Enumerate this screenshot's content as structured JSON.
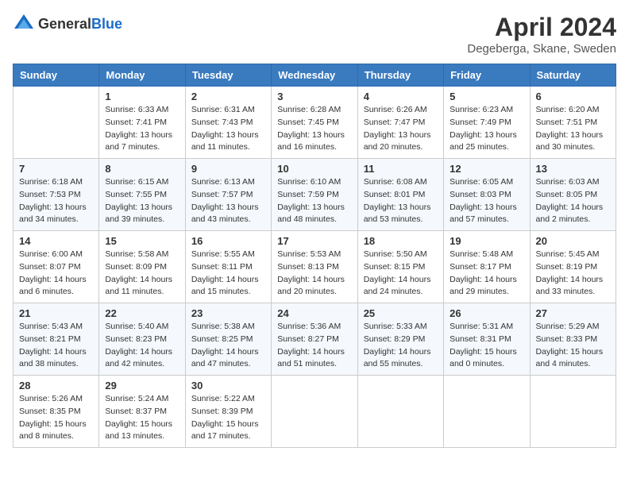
{
  "header": {
    "logo_general": "General",
    "logo_blue": "Blue",
    "month_title": "April 2024",
    "location": "Degeberga, Skane, Sweden"
  },
  "weekdays": [
    "Sunday",
    "Monday",
    "Tuesday",
    "Wednesday",
    "Thursday",
    "Friday",
    "Saturday"
  ],
  "weeks": [
    [
      {
        "day": "",
        "info": ""
      },
      {
        "day": "1",
        "info": "Sunrise: 6:33 AM\nSunset: 7:41 PM\nDaylight: 13 hours\nand 7 minutes."
      },
      {
        "day": "2",
        "info": "Sunrise: 6:31 AM\nSunset: 7:43 PM\nDaylight: 13 hours\nand 11 minutes."
      },
      {
        "day": "3",
        "info": "Sunrise: 6:28 AM\nSunset: 7:45 PM\nDaylight: 13 hours\nand 16 minutes."
      },
      {
        "day": "4",
        "info": "Sunrise: 6:26 AM\nSunset: 7:47 PM\nDaylight: 13 hours\nand 20 minutes."
      },
      {
        "day": "5",
        "info": "Sunrise: 6:23 AM\nSunset: 7:49 PM\nDaylight: 13 hours\nand 25 minutes."
      },
      {
        "day": "6",
        "info": "Sunrise: 6:20 AM\nSunset: 7:51 PM\nDaylight: 13 hours\nand 30 minutes."
      }
    ],
    [
      {
        "day": "7",
        "info": "Sunrise: 6:18 AM\nSunset: 7:53 PM\nDaylight: 13 hours\nand 34 minutes."
      },
      {
        "day": "8",
        "info": "Sunrise: 6:15 AM\nSunset: 7:55 PM\nDaylight: 13 hours\nand 39 minutes."
      },
      {
        "day": "9",
        "info": "Sunrise: 6:13 AM\nSunset: 7:57 PM\nDaylight: 13 hours\nand 43 minutes."
      },
      {
        "day": "10",
        "info": "Sunrise: 6:10 AM\nSunset: 7:59 PM\nDaylight: 13 hours\nand 48 minutes."
      },
      {
        "day": "11",
        "info": "Sunrise: 6:08 AM\nSunset: 8:01 PM\nDaylight: 13 hours\nand 53 minutes."
      },
      {
        "day": "12",
        "info": "Sunrise: 6:05 AM\nSunset: 8:03 PM\nDaylight: 13 hours\nand 57 minutes."
      },
      {
        "day": "13",
        "info": "Sunrise: 6:03 AM\nSunset: 8:05 PM\nDaylight: 14 hours\nand 2 minutes."
      }
    ],
    [
      {
        "day": "14",
        "info": "Sunrise: 6:00 AM\nSunset: 8:07 PM\nDaylight: 14 hours\nand 6 minutes."
      },
      {
        "day": "15",
        "info": "Sunrise: 5:58 AM\nSunset: 8:09 PM\nDaylight: 14 hours\nand 11 minutes."
      },
      {
        "day": "16",
        "info": "Sunrise: 5:55 AM\nSunset: 8:11 PM\nDaylight: 14 hours\nand 15 minutes."
      },
      {
        "day": "17",
        "info": "Sunrise: 5:53 AM\nSunset: 8:13 PM\nDaylight: 14 hours\nand 20 minutes."
      },
      {
        "day": "18",
        "info": "Sunrise: 5:50 AM\nSunset: 8:15 PM\nDaylight: 14 hours\nand 24 minutes."
      },
      {
        "day": "19",
        "info": "Sunrise: 5:48 AM\nSunset: 8:17 PM\nDaylight: 14 hours\nand 29 minutes."
      },
      {
        "day": "20",
        "info": "Sunrise: 5:45 AM\nSunset: 8:19 PM\nDaylight: 14 hours\nand 33 minutes."
      }
    ],
    [
      {
        "day": "21",
        "info": "Sunrise: 5:43 AM\nSunset: 8:21 PM\nDaylight: 14 hours\nand 38 minutes."
      },
      {
        "day": "22",
        "info": "Sunrise: 5:40 AM\nSunset: 8:23 PM\nDaylight: 14 hours\nand 42 minutes."
      },
      {
        "day": "23",
        "info": "Sunrise: 5:38 AM\nSunset: 8:25 PM\nDaylight: 14 hours\nand 47 minutes."
      },
      {
        "day": "24",
        "info": "Sunrise: 5:36 AM\nSunset: 8:27 PM\nDaylight: 14 hours\nand 51 minutes."
      },
      {
        "day": "25",
        "info": "Sunrise: 5:33 AM\nSunset: 8:29 PM\nDaylight: 14 hours\nand 55 minutes."
      },
      {
        "day": "26",
        "info": "Sunrise: 5:31 AM\nSunset: 8:31 PM\nDaylight: 15 hours\nand 0 minutes."
      },
      {
        "day": "27",
        "info": "Sunrise: 5:29 AM\nSunset: 8:33 PM\nDaylight: 15 hours\nand 4 minutes."
      }
    ],
    [
      {
        "day": "28",
        "info": "Sunrise: 5:26 AM\nSunset: 8:35 PM\nDaylight: 15 hours\nand 8 minutes."
      },
      {
        "day": "29",
        "info": "Sunrise: 5:24 AM\nSunset: 8:37 PM\nDaylight: 15 hours\nand 13 minutes."
      },
      {
        "day": "30",
        "info": "Sunrise: 5:22 AM\nSunset: 8:39 PM\nDaylight: 15 hours\nand 17 minutes."
      },
      {
        "day": "",
        "info": ""
      },
      {
        "day": "",
        "info": ""
      },
      {
        "day": "",
        "info": ""
      },
      {
        "day": "",
        "info": ""
      }
    ]
  ]
}
